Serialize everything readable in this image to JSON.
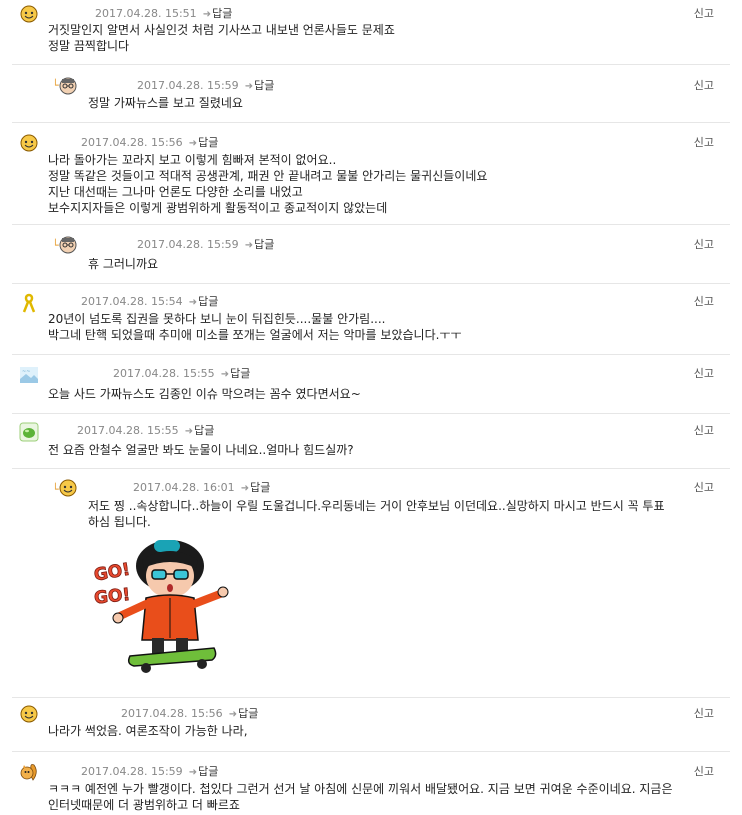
{
  "reply_label": "답글",
  "report_label": "신고",
  "comments": [
    {
      "time": "2017.04.28. 15:51",
      "text": "거짓말인지 알면서 사실인것 처럼 기사쓰고 내보낸 언론사들도 문제죠\n정말 끔찍합니다",
      "avatar": "smiley-avatar-icon"
    },
    {
      "time": "2017.04.28. 15:59",
      "text": "정말 가짜뉴스를 보고 질렸네요",
      "avatar": "glasses-avatar-icon"
    },
    {
      "time": "2017.04.28. 15:56",
      "text": "나라 돌아가는 꼬라지 보고 이렇게 힘빠져 본적이 없어요..\n정말 똑같은 것들이고 적대적 공생관계, 패권 안 끝내려고 물불 안가리는 물귀신들이네요\n지난 대선때는 그나마 언론도 다양한 소리를 내었고\n보수지지자들은 이렇게 광범위하게 활동적이고 종교적이지 않았는데",
      "avatar": "smiley-avatar-icon"
    },
    {
      "time": "2017.04.28. 15:59",
      "text": "휴 그러니까요",
      "avatar": "glasses-avatar-icon"
    },
    {
      "time": "2017.04.28. 15:54",
      "text": "20년이 넘도록 집권을 못하다 보니 눈이 뒤집힌듯....물불 안가림....\n박그네 탄핵 되었을때 추미애 미소를 쪼개는 얼굴에서 저는 악마를 보았습니다.ㅜㅜ",
      "avatar": "yellow-ribbon-icon"
    },
    {
      "time": "2017.04.28. 15:55",
      "text": "오늘 사드 가짜뉴스도 김종인 이슈 막으려는 꼼수 였다면서요~",
      "avatar": "scenery-avatar-icon"
    },
    {
      "time": "2017.04.28. 15:55",
      "text": "전 요즘 안철수 얼굴만 봐도 눈물이 나네요..얼마나 힘드실까?",
      "avatar": "green-avatar-icon"
    },
    {
      "time": "2017.04.28. 16:01",
      "text": "저도 찡 ..속상합니다..하늘이 우릴 도울겁니다.우리동네는 거이 안후보님 이던데요..실망하지 마시고 반드시 꼭 투표\n하심 됩니다.",
      "avatar": "smiley-avatar-icon",
      "sticker_text": "GO! GO!"
    },
    {
      "time": "2017.04.28. 15:56",
      "text": "나라가 썩었음. 여론조작이 가능한 나라,",
      "avatar": "smiley-avatar-icon"
    },
    {
      "time": "2017.04.28. 15:59",
      "text": "ㅋㅋㅋ 예전엔 누가 빨갱이다. 첩있다 그런거 선거 날 아침에 신문에 끼워서 배달됐어요. 지금 보면 귀여운 수준이네요. 지금은\n인터넷때문에 더 광범위하고 더 빠르죠",
      "avatar": "squirrel-avatar-icon"
    }
  ]
}
